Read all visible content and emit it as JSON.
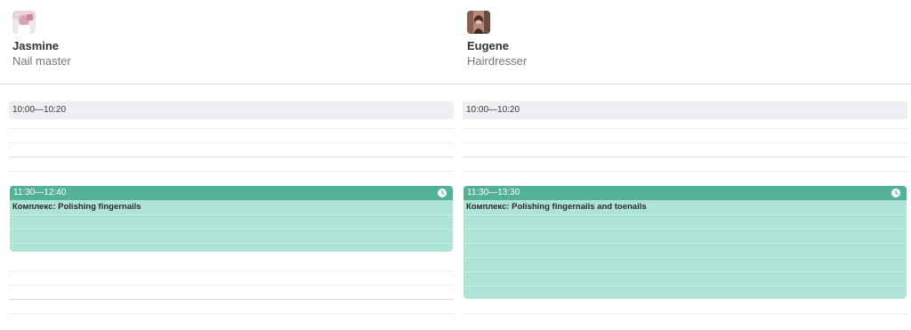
{
  "staff": [
    {
      "name": "Jasmine",
      "role": "Nail master",
      "avatar_icon": "avatar-photo",
      "blocked_time": "10:00—10:20",
      "appointment": {
        "time": "11:30—12:40",
        "title": "Комплекс: Polishing fingernails",
        "icon": "clock-icon"
      }
    },
    {
      "name": "Eugene",
      "role": "Hairdresser",
      "avatar_icon": "avatar-photo",
      "blocked_time": "10:00—10:20",
      "appointment": {
        "time": "11:30—13:30",
        "title": "Комплекс: Polishing fingernails and toenails",
        "icon": "clock-icon"
      }
    }
  ],
  "colors": {
    "appointment_header": "#52b196",
    "appointment_body": "#aee4d8",
    "blocked_slot": "#eeeff3"
  }
}
